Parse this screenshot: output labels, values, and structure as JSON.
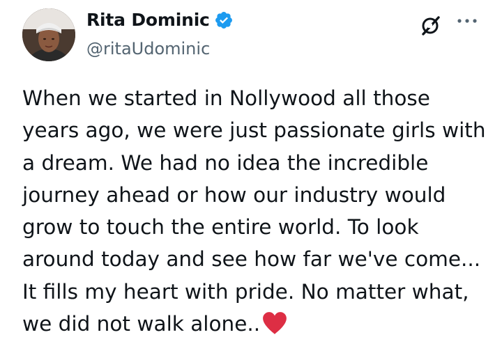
{
  "author": {
    "name": "Rita Dominic",
    "handle": "@ritaUdominic",
    "verified": true,
    "verified_color": "#1d9bf0"
  },
  "icons": {
    "verified": "verified-badge-icon",
    "grok": "grok-icon",
    "more": "more-options-icon",
    "heart": "red-heart-emoji",
    "heart_color": "#dd2e44"
  },
  "post": {
    "lines": [
      "When we started in Nollywood all those",
      "years ago, we were just passionate girls with",
      "a dream. We had no idea the incredible",
      "journey ahead or how our industry would",
      "grow to touch the entire world. To look",
      "around today and see how far we've come...",
      "It fills my heart with pride. No matter what,",
      "we did not walk alone.."
    ]
  }
}
